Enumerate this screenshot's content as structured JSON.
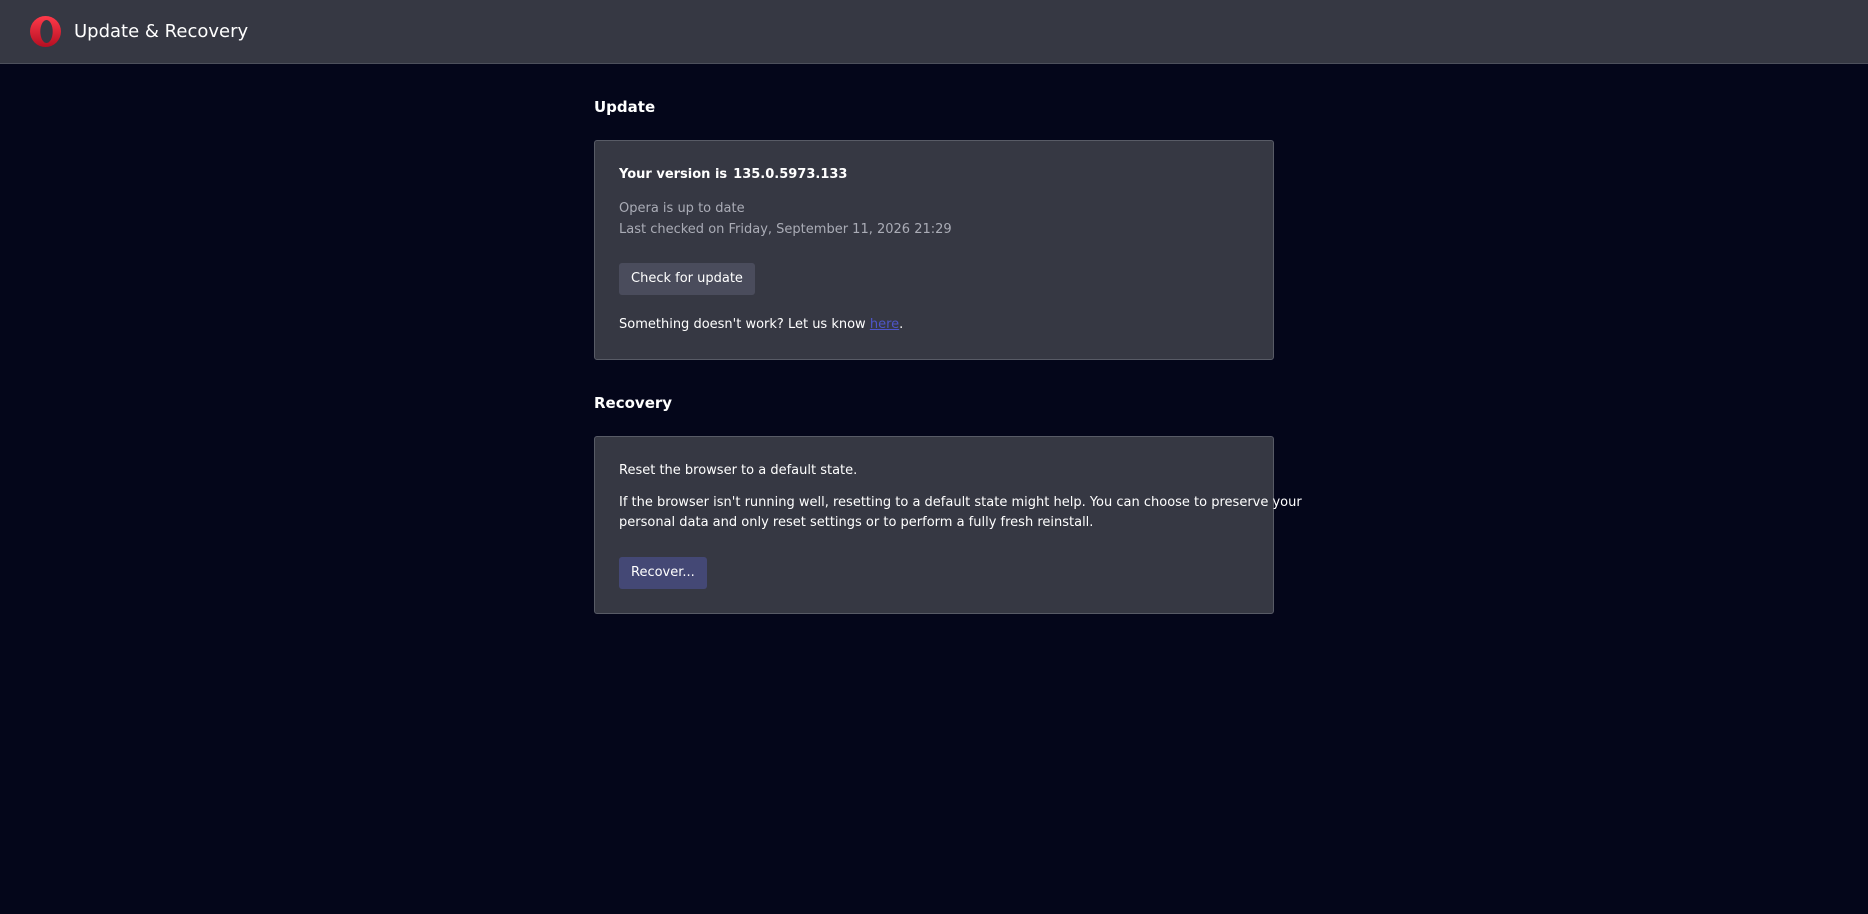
{
  "header": {
    "title": "Update & Recovery",
    "logo_icon": "opera-logo-icon",
    "logo_color": "#e0162b"
  },
  "update": {
    "heading": "Update",
    "version_label": "Your version is",
    "version_number": "135.0.5973.133",
    "status": "Opera is up to date",
    "last_checked": "Last checked on Friday, September 11, 2026 21:29",
    "check_button_label": "Check for update",
    "feedback_prefix": "Something doesn't work? Let us know ",
    "feedback_link": "here",
    "feedback_suffix": "."
  },
  "recovery": {
    "heading": "Recovery",
    "intro": "Reset the browser to a default state.",
    "description_line1": "If the browser isn't running well, resetting to a default state might help. You can choose to preserve your",
    "description_line2": "personal data and only reset settings or to perform a fully fresh reinstall.",
    "recover_button_label": "Recover..."
  },
  "colors": {
    "background": "#04061a",
    "surface": "#363843",
    "link": "#4e55c9",
    "recover_button": "#444875"
  }
}
